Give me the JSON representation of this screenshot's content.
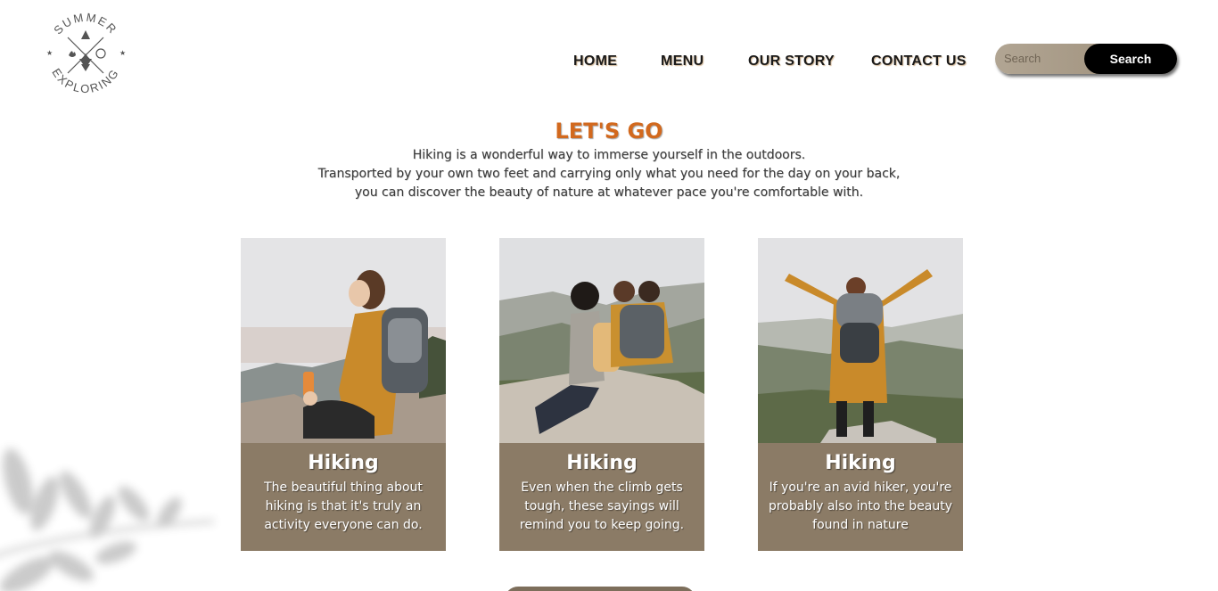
{
  "logo": {
    "top_text": "SUMMER",
    "bottom_text": "EXPLORING"
  },
  "nav": {
    "items": [
      {
        "label": "HOME"
      },
      {
        "label": "MENU"
      },
      {
        "label": "OUR STORY"
      },
      {
        "label": "CONTACT US"
      }
    ]
  },
  "search": {
    "placeholder": "Search",
    "button_label": "Search"
  },
  "intro": {
    "title": "LET'S GO",
    "lines": [
      "Hiking is a wonderful way to immerse yourself in the outdoors.",
      "Transported by your own two feet and carrying only what you need for the day on your back,",
      "you can discover the beauty of nature at whatever pace you're comfortable with."
    ]
  },
  "cards": [
    {
      "title": "Hiking",
      "text": "The beautiful thing about hiking is that it's truly an activity everyone can do."
    },
    {
      "title": "Hiking",
      "text": "Even when the climb gets tough, these sayings will remind you to keep going."
    },
    {
      "title": "Hiking",
      "text": "If you're an avid hiker, you're probably also into the beauty found in nature"
    }
  ],
  "colors": {
    "accent": "#d2691e",
    "card_bg": "#8b7b66",
    "search_bg": "#a89a86",
    "search_button_bg": "#000000"
  }
}
